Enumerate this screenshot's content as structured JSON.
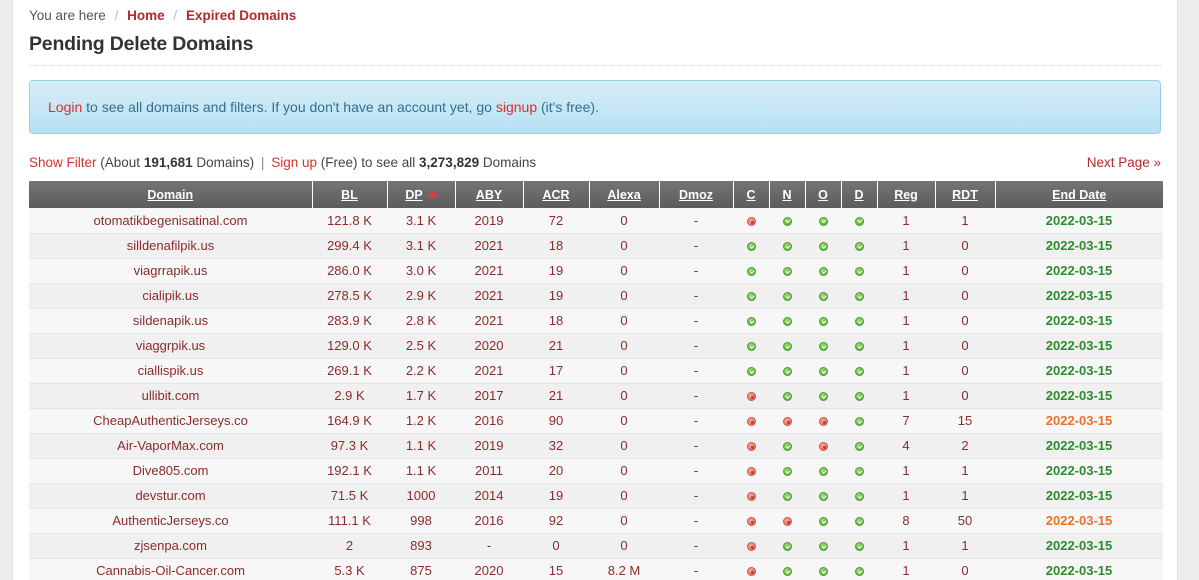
{
  "breadcrumb": {
    "prefix": "You are here",
    "sep": "/",
    "home": "Home",
    "current": "Expired Domains"
  },
  "page_title": "Pending Delete Domains",
  "banner": {
    "login_link": "Login",
    "text_1": " to see all domains and filters. If you don't have an account yet, go ",
    "signup_link": "signup",
    "text_2": " (it's free)."
  },
  "filterbar": {
    "show_filter": "Show Filter",
    "about_prefix": " (About ",
    "domain_count": "191,681",
    "about_suffix": " Domains)",
    "pipe": "|",
    "signup": "Sign up",
    "free_text": " (Free) to see all ",
    "total_count": "3,273,829",
    "total_suffix": " Domains",
    "next_page": "Next Page »"
  },
  "table": {
    "columns": [
      {
        "key": "domain",
        "label": "Domain",
        "sorted": false
      },
      {
        "key": "bl",
        "label": "BL",
        "sorted": false
      },
      {
        "key": "dp",
        "label": "DP",
        "sorted": true
      },
      {
        "key": "aby",
        "label": "ABY",
        "sorted": false
      },
      {
        "key": "acr",
        "label": "ACR",
        "sorted": false
      },
      {
        "key": "alexa",
        "label": "Alexa",
        "sorted": false
      },
      {
        "key": "dmoz",
        "label": "Dmoz",
        "sorted": false
      },
      {
        "key": "c",
        "label": "C",
        "sorted": false
      },
      {
        "key": "n",
        "label": "N",
        "sorted": false
      },
      {
        "key": "o",
        "label": "O",
        "sorted": false
      },
      {
        "key": "d",
        "label": "D",
        "sorted": false
      },
      {
        "key": "reg",
        "label": "Reg",
        "sorted": false
      },
      {
        "key": "rdt",
        "label": "RDT",
        "sorted": false
      },
      {
        "key": "end_date",
        "label": "End Date",
        "sorted": false
      }
    ],
    "sort_indicator": "ascending-triangle",
    "rows": [
      {
        "domain": "otomatikbegenisatinal.com",
        "bl": "121.8 K",
        "dp": "3.1 K",
        "aby": "2019",
        "acr": "72",
        "alexa": "0",
        "dmoz": "-",
        "c": "red",
        "n": "green",
        "o": "green",
        "d": "green",
        "reg": "1",
        "rdt": "1",
        "end_date": "2022-03-15",
        "end_date_color": "green"
      },
      {
        "domain": "silldenafilpik.us",
        "bl": "299.4 K",
        "dp": "3.1 K",
        "aby": "2021",
        "acr": "18",
        "alexa": "0",
        "dmoz": "-",
        "c": "green",
        "n": "green",
        "o": "green",
        "d": "green",
        "reg": "1",
        "rdt": "0",
        "end_date": "2022-03-15",
        "end_date_color": "green"
      },
      {
        "domain": "viagrrapik.us",
        "bl": "286.0 K",
        "dp": "3.0 K",
        "aby": "2021",
        "acr": "19",
        "alexa": "0",
        "dmoz": "-",
        "c": "green",
        "n": "green",
        "o": "green",
        "d": "green",
        "reg": "1",
        "rdt": "0",
        "end_date": "2022-03-15",
        "end_date_color": "green"
      },
      {
        "domain": "cialipik.us",
        "bl": "278.5 K",
        "dp": "2.9 K",
        "aby": "2021",
        "acr": "19",
        "alexa": "0",
        "dmoz": "-",
        "c": "green",
        "n": "green",
        "o": "green",
        "d": "green",
        "reg": "1",
        "rdt": "0",
        "end_date": "2022-03-15",
        "end_date_color": "green"
      },
      {
        "domain": "sildenapik.us",
        "bl": "283.9 K",
        "dp": "2.8 K",
        "aby": "2021",
        "acr": "18",
        "alexa": "0",
        "dmoz": "-",
        "c": "green",
        "n": "green",
        "o": "green",
        "d": "green",
        "reg": "1",
        "rdt": "0",
        "end_date": "2022-03-15",
        "end_date_color": "green"
      },
      {
        "domain": "viaggrpik.us",
        "bl": "129.0 K",
        "dp": "2.5 K",
        "aby": "2020",
        "acr": "21",
        "alexa": "0",
        "dmoz": "-",
        "c": "green",
        "n": "green",
        "o": "green",
        "d": "green",
        "reg": "1",
        "rdt": "0",
        "end_date": "2022-03-15",
        "end_date_color": "green"
      },
      {
        "domain": "ciallispik.us",
        "bl": "269.1 K",
        "dp": "2.2 K",
        "aby": "2021",
        "acr": "17",
        "alexa": "0",
        "dmoz": "-",
        "c": "green",
        "n": "green",
        "o": "green",
        "d": "green",
        "reg": "1",
        "rdt": "0",
        "end_date": "2022-03-15",
        "end_date_color": "green"
      },
      {
        "domain": "ullibit.com",
        "bl": "2.9 K",
        "dp": "1.7 K",
        "aby": "2017",
        "acr": "21",
        "alexa": "0",
        "dmoz": "-",
        "c": "red",
        "n": "green",
        "o": "green",
        "d": "green",
        "reg": "1",
        "rdt": "0",
        "end_date": "2022-03-15",
        "end_date_color": "green"
      },
      {
        "domain": "CheapAuthenticJerseys.co",
        "bl": "164.9 K",
        "dp": "1.2 K",
        "aby": "2016",
        "acr": "90",
        "alexa": "0",
        "dmoz": "-",
        "c": "red",
        "n": "red",
        "o": "red",
        "d": "green",
        "reg": "7",
        "rdt": "15",
        "end_date": "2022-03-15",
        "end_date_color": "orange"
      },
      {
        "domain": "Air-VaporMax.com",
        "bl": "97.3 K",
        "dp": "1.1 K",
        "aby": "2019",
        "acr": "32",
        "alexa": "0",
        "dmoz": "-",
        "c": "red",
        "n": "green",
        "o": "red",
        "d": "green",
        "reg": "4",
        "rdt": "2",
        "end_date": "2022-03-15",
        "end_date_color": "green"
      },
      {
        "domain": "Dive805.com",
        "bl": "192.1 K",
        "dp": "1.1 K",
        "aby": "2011",
        "acr": "20",
        "alexa": "0",
        "dmoz": "-",
        "c": "red",
        "n": "green",
        "o": "green",
        "d": "green",
        "reg": "1",
        "rdt": "1",
        "end_date": "2022-03-15",
        "end_date_color": "green"
      },
      {
        "domain": "devstur.com",
        "bl": "71.5 K",
        "dp": "1000",
        "aby": "2014",
        "acr": "19",
        "alexa": "0",
        "dmoz": "-",
        "c": "red",
        "n": "green",
        "o": "green",
        "d": "green",
        "reg": "1",
        "rdt": "1",
        "end_date": "2022-03-15",
        "end_date_color": "green"
      },
      {
        "domain": "AuthenticJerseys.co",
        "bl": "111.1 K",
        "dp": "998",
        "aby": "2016",
        "acr": "92",
        "alexa": "0",
        "dmoz": "-",
        "c": "red",
        "n": "red",
        "o": "green",
        "d": "green",
        "reg": "8",
        "rdt": "50",
        "end_date": "2022-03-15",
        "end_date_color": "orange"
      },
      {
        "domain": "zjsenpa.com",
        "bl": "2",
        "dp": "893",
        "aby": "-",
        "acr": "0",
        "alexa": "0",
        "dmoz": "-",
        "c": "red",
        "n": "green",
        "o": "green",
        "d": "green",
        "reg": "1",
        "rdt": "1",
        "end_date": "2022-03-15",
        "end_date_color": "green"
      },
      {
        "domain": "Cannabis-Oil-Cancer.com",
        "bl": "5.3 K",
        "dp": "875",
        "aby": "2020",
        "acr": "15",
        "alexa": "8.2 M",
        "dmoz": "-",
        "c": "red",
        "n": "green",
        "o": "green",
        "d": "green",
        "reg": "1",
        "rdt": "0",
        "end_date": "2022-03-15",
        "end_date_color": "green"
      }
    ]
  },
  "colors": {
    "link_red": "#b02b2c",
    "accent_red": "#d0342c",
    "domain_text": "#8b2b2b",
    "date_green": "#2d8a2d",
    "date_orange": "#e8712c",
    "banner_text": "#31708f",
    "header_gray": "#666666"
  }
}
